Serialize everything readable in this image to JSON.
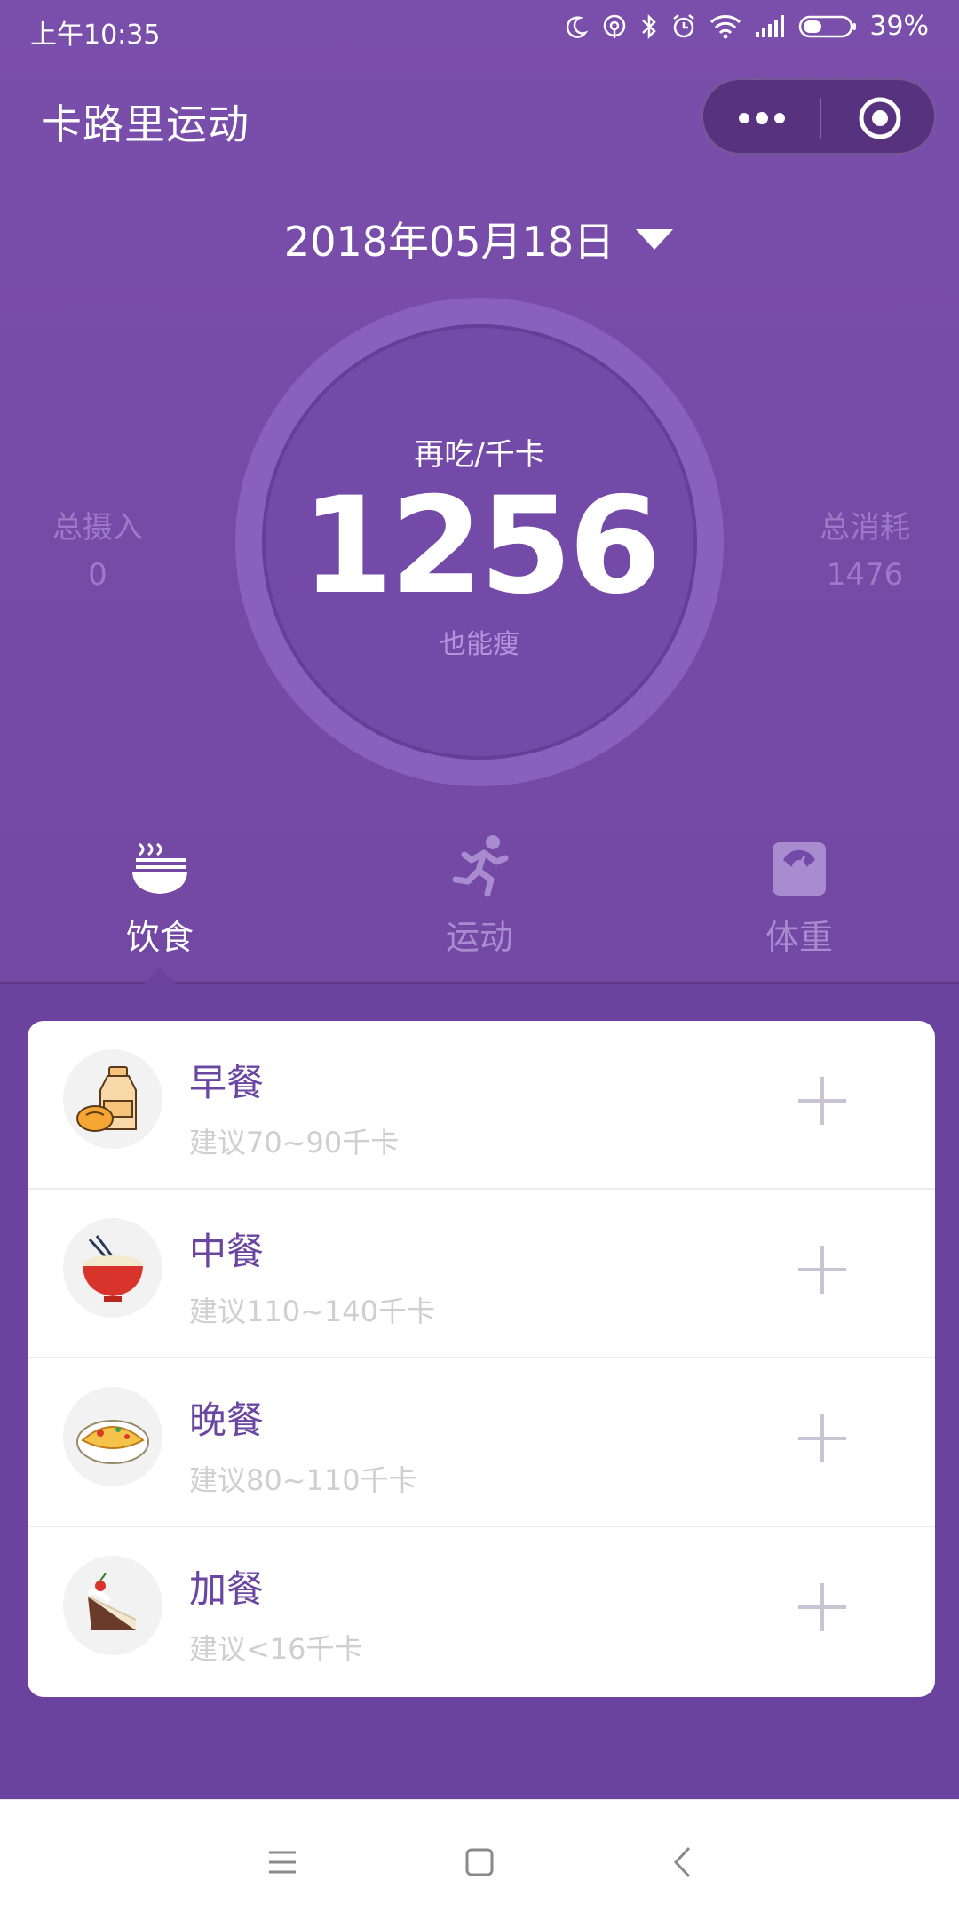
{
  "status_bar": {
    "time": "上午10:35",
    "battery": "39%"
  },
  "header": {
    "title": "卡路里运动"
  },
  "date": {
    "value": "2018年05月18日"
  },
  "summary": {
    "remaining_label": "再吃/千卡",
    "remaining_value": "1256",
    "remaining_sub": "也能瘦",
    "intake_label": "总摄入",
    "intake_value": "0",
    "burn_label": "总消耗",
    "burn_value": "1476"
  },
  "tabs": [
    {
      "label": "饮食",
      "icon": "noodle-bowl-icon",
      "active": true
    },
    {
      "label": "运动",
      "icon": "running-icon",
      "active": false
    },
    {
      "label": "体重",
      "icon": "scale-icon",
      "active": false
    }
  ],
  "meals": [
    {
      "name": "早餐",
      "hint": "建议70~90千卡",
      "icon": "milk-bun-icon"
    },
    {
      "name": "中餐",
      "hint": "建议110~140千卡",
      "icon": "rice-bowl-icon"
    },
    {
      "name": "晚餐",
      "hint": "建议80~110千卡",
      "icon": "omelette-plate-icon"
    },
    {
      "name": "加餐",
      "hint": "建议<16千卡",
      "icon": "cake-slice-icon"
    }
  ],
  "colors": {
    "primary": "#7a4eab",
    "accent_text": "#6b46a1",
    "muted": "#cfcfcf"
  }
}
